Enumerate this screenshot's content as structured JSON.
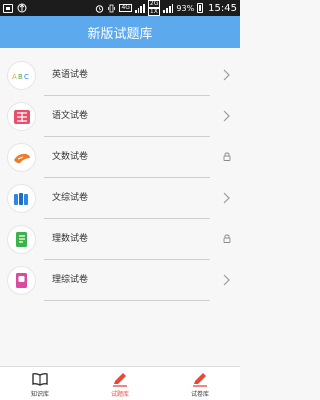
{
  "status_bar": {
    "signal_tag": "4G",
    "data_tags": [
      "2G",
      "1X"
    ],
    "battery_percent": "93%",
    "time": "15:45",
    "icons": [
      "notification-icon",
      "usb-icon",
      "alarm-icon",
      "vibrate-icon",
      "signal-icon",
      "battery-icon"
    ]
  },
  "header": {
    "title": "新版试题库"
  },
  "list": {
    "items": [
      {
        "label": "英语试卷",
        "icon": "abc-icon",
        "trailing": "chevron",
        "color": "#f0a62a"
      },
      {
        "label": "语文试卷",
        "icon": "language-icon",
        "trailing": "chevron",
        "color": "#e94e6a"
      },
      {
        "label": "文数试卷",
        "icon": "math-icon",
        "trailing": "lock",
        "color": "#f07b2a"
      },
      {
        "label": "文综试卷",
        "icon": "books-icon",
        "trailing": "chevron",
        "color": "#2e86de"
      },
      {
        "label": "理数试卷",
        "icon": "book-green-icon",
        "trailing": "lock",
        "color": "#3bb34a"
      },
      {
        "label": "理综试卷",
        "icon": "book-pink-icon",
        "trailing": "chevron",
        "color": "#d94ca0"
      }
    ]
  },
  "tabbar": {
    "tabs": [
      {
        "label": "知识库",
        "icon": "book-open-icon",
        "active": false
      },
      {
        "label": "试题库",
        "icon": "pencil-icon",
        "active": true
      },
      {
        "label": "试卷库",
        "icon": "pencil-icon",
        "active": false
      }
    ],
    "accent": "#e8473a"
  }
}
